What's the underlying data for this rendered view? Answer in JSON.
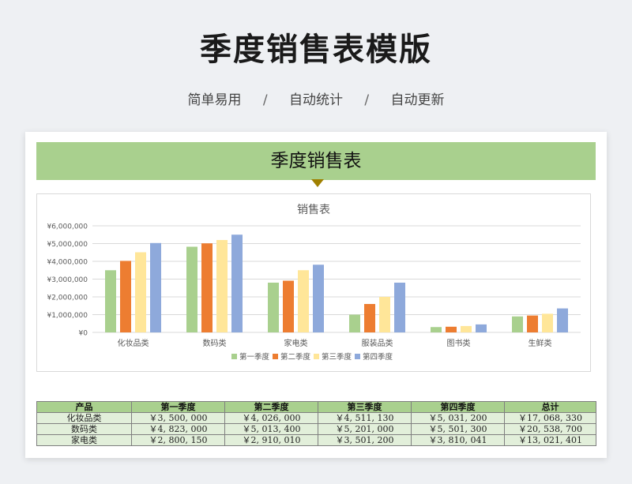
{
  "page": {
    "title": "季度销售表模版",
    "tags": [
      "简单易用",
      "自动统计",
      "自动更新"
    ],
    "separator": "/"
  },
  "sheet": {
    "banner_title": "季度销售表"
  },
  "colors": {
    "banner": "#a9d08e",
    "header": "#a9d08e",
    "row": "#e2efda",
    "q1": "#a9d08e",
    "q2": "#ed7d31",
    "q3": "#ffe699",
    "q4": "#8ea9db"
  },
  "chart_data": {
    "type": "bar",
    "title": "销售表",
    "xlabel": "",
    "ylabel": "",
    "ylim": [
      0,
      6000000
    ],
    "y_ticks": [
      0,
      1000000,
      2000000,
      3000000,
      4000000,
      5000000,
      6000000
    ],
    "y_tick_labels": [
      "¥0",
      "¥1,000,000",
      "¥2,000,000",
      "¥3,000,000",
      "¥4,000,000",
      "¥5,000,000",
      "¥6,000,000"
    ],
    "grid": true,
    "legend": "bottom",
    "categories": [
      "化妆品类",
      "数码类",
      "家电类",
      "服装品类",
      "图书类",
      "生鲜类"
    ],
    "series": [
      {
        "name": "第一季度",
        "color": "#a9d08e",
        "values": [
          3500000,
          4823000,
          2800150,
          1000000,
          300000,
          900000
        ]
      },
      {
        "name": "第二季度",
        "color": "#ed7d31",
        "values": [
          4026000,
          5013400,
          2910010,
          1600000,
          320000,
          950000
        ]
      },
      {
        "name": "第三季度",
        "color": "#ffe699",
        "values": [
          4511130,
          5201000,
          3501200,
          2000000,
          360000,
          1050000
        ]
      },
      {
        "name": "第四季度",
        "color": "#8ea9db",
        "values": [
          5031200,
          5501300,
          3810041,
          2800000,
          450000,
          1350000
        ]
      }
    ]
  },
  "table": {
    "headers": [
      "产品",
      "第一季度",
      "第二季度",
      "第三季度",
      "第四季度",
      "总计"
    ],
    "rows": [
      [
        "化妆品类",
        "￥3, 500, 000",
        "￥4, 026, 000",
        "￥4, 511, 130",
        "￥5, 031, 200",
        "￥17, 068, 330"
      ],
      [
        "数码类",
        "￥4, 823, 000",
        "￥5, 013, 400",
        "￥5, 201, 000",
        "￥5, 501, 300",
        "￥20, 538, 700"
      ],
      [
        "家电类",
        "￥2, 800, 150",
        "￥2, 910, 010",
        "￥3, 501, 200",
        "￥3, 810, 041",
        "￥13, 021, 401"
      ]
    ]
  }
}
